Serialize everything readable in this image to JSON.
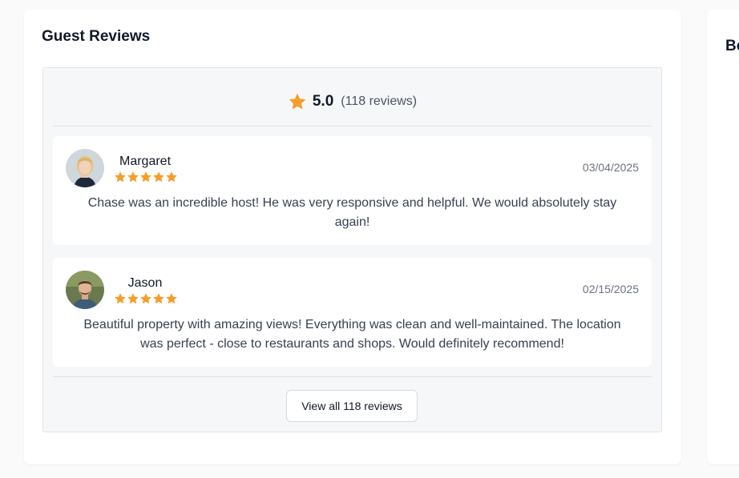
{
  "reviews_section": {
    "title": "Guest Reviews",
    "rating": "5.0",
    "review_count_text": "(118 reviews)",
    "star_color": "#f59e2b",
    "reviews": [
      {
        "name": "Margaret",
        "stars": 5,
        "date": "03/04/2025",
        "text": "Chase was an incredible host! He was very responsive and helpful. We would absolutely stay again!"
      },
      {
        "name": "Jason",
        "stars": 5,
        "date": "02/15/2025",
        "text": "Beautiful property with amazing views! Everything was clean and well-maintained. The location was perfect - close to restaurants and shops. Would definitely recommend!"
      }
    ],
    "view_all_label": "View all 118 reviews"
  },
  "side_panel": {
    "title": "Bo"
  }
}
